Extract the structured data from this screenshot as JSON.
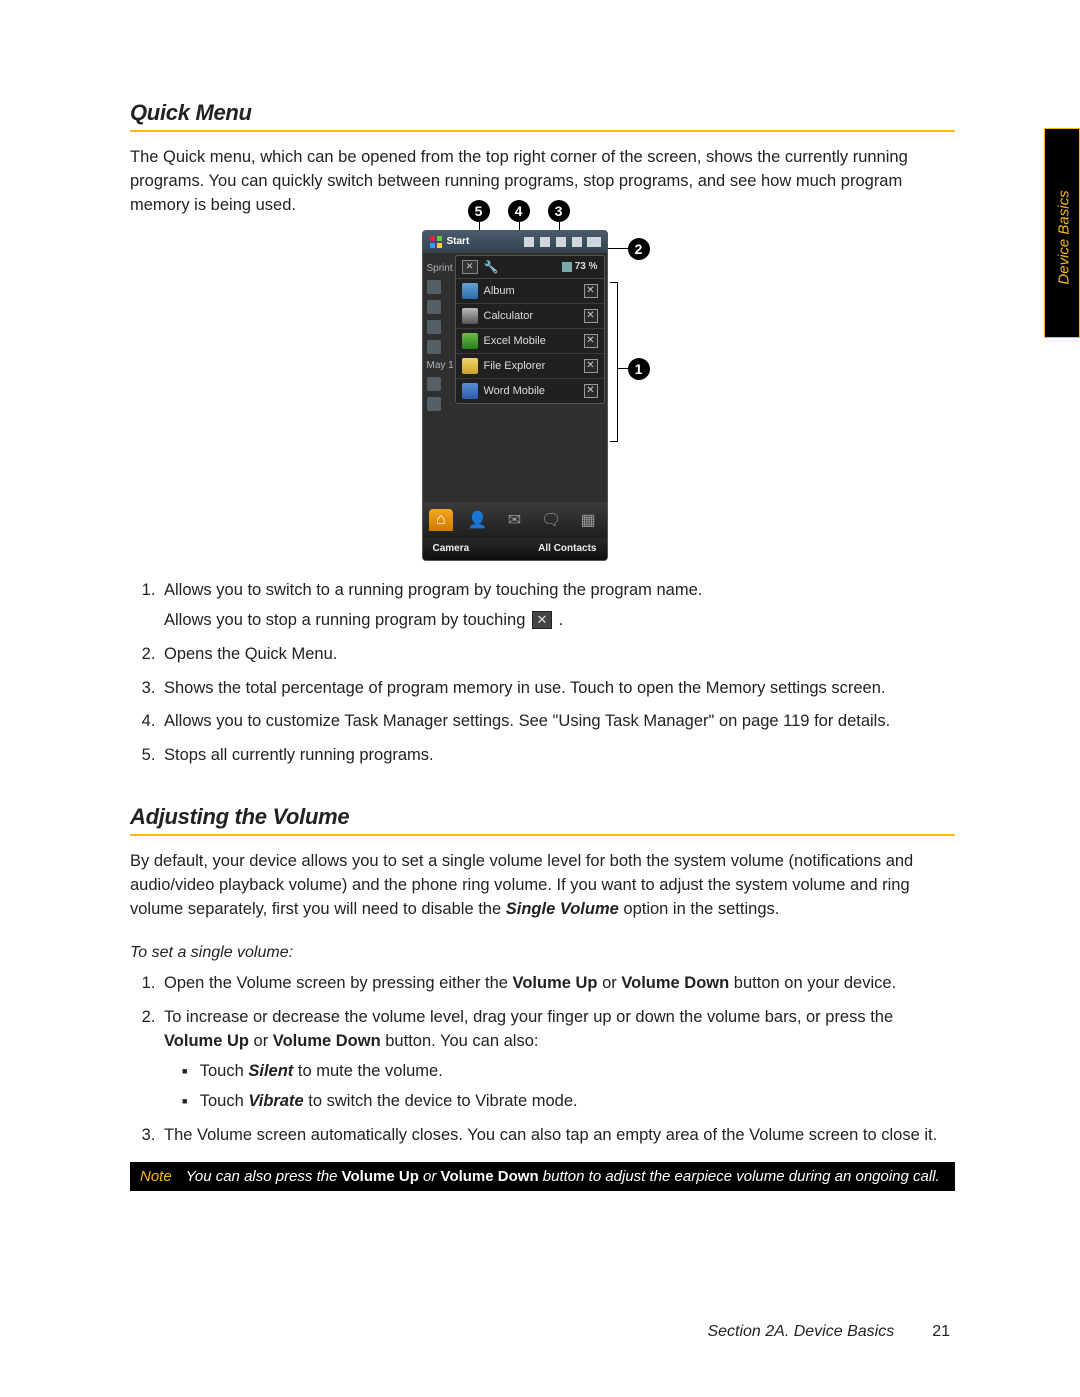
{
  "sideTab": "Device Basics",
  "heading1": "Quick Menu",
  "intro": "The Quick menu, which can be opened from the top right corner of the screen, shows the currently running programs. You can quickly switch between running programs, stop programs, and see how much program memory is being used.",
  "screenshot": {
    "start": "Start",
    "carrier": "Sprint",
    "memory": "73 %",
    "date": "May 1",
    "apps": [
      "Album",
      "Calculator",
      "Excel Mobile",
      "File Explorer",
      "Word Mobile"
    ],
    "softLeft": "Camera",
    "softRight": "All Contacts"
  },
  "callouts": {
    "c1": "1",
    "c2": "2",
    "c3": "3",
    "c4": "4",
    "c5": "5"
  },
  "list1": {
    "i1a": "Allows you to switch to a running program by touching the program name.",
    "i1b_pre": "Allows you to stop a running program by touching ",
    "i1b_post": " .",
    "i2": "Opens the Quick Menu.",
    "i3": "Shows the total percentage of program memory in use. Touch to open the Memory settings screen.",
    "i4": "Allows you to customize Task Manager settings. See \"Using Task Manager\" on page 119 for details.",
    "i5": "Stops all currently running programs."
  },
  "heading2": "Adjusting the Volume",
  "vol_intro_pre": "By default, your device allows you to set a single volume level for both the system volume (notifications and audio/video playback volume) and the phone ring volume. If you want to adjust the system volume and ring volume separately, first you will need to disable the ",
  "vol_intro_bold": "Single Volume",
  "vol_intro_post": " option in the settings.",
  "subhead": "To set a single volume:",
  "vol_list": {
    "i1_pre": "Open the Volume screen by pressing either the ",
    "i1_b1": "Volume Up",
    "i1_mid": " or ",
    "i1_b2": "Volume Down",
    "i1_post": " button on your device.",
    "i2_pre": "To increase or decrease the volume level, drag your finger up or down the volume bars, or press the ",
    "i2_b1": "Volume Up",
    "i2_mid": " or ",
    "i2_b2": "Volume Down",
    "i2_post": " button. You can also:",
    "i2_bul1_pre": "Touch ",
    "i2_bul1_b": "Silent",
    "i2_bul1_post": " to mute the volume.",
    "i2_bul2_pre": "Touch ",
    "i2_bul2_b": "Vibrate",
    "i2_bul2_post": " to switch the device to Vibrate mode.",
    "i3": "The Volume screen automatically closes. You can also tap an empty area of the Volume screen to close it."
  },
  "note": {
    "label": "Note",
    "pre": "You can also press the ",
    "b1": "Volume Up",
    "mid": " or ",
    "b2": "Volume Down",
    "post": " button to adjust the earpiece volume during an ongoing call."
  },
  "footer": {
    "section": "Section 2A. Device Basics",
    "page": "21"
  }
}
